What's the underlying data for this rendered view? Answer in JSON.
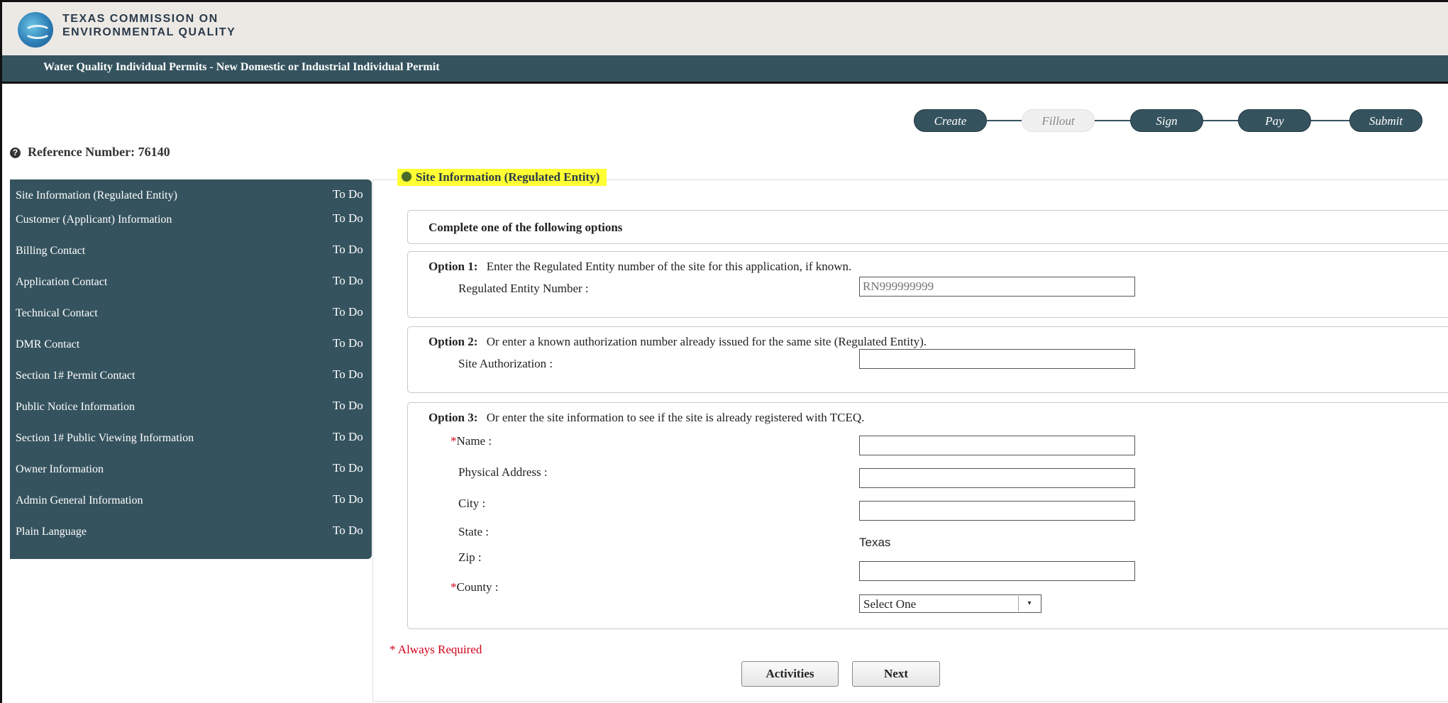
{
  "agency": {
    "line1": "TEXAS COMMISSION ON",
    "line2": "ENVIRONMENTAL QUALITY"
  },
  "title_bar": "Water Quality Individual Permits - New Domestic or Industrial Individual Permit",
  "steps": [
    {
      "label": "Create",
      "active": true
    },
    {
      "label": "Fillout",
      "active": false
    },
    {
      "label": "Sign",
      "active": true
    },
    {
      "label": "Pay",
      "active": true
    },
    {
      "label": "Submit",
      "active": true
    }
  ],
  "reference": {
    "label": "Reference Number: 76140"
  },
  "sidebar": {
    "items": [
      {
        "label": "Site Information (Regulated Entity)",
        "status": "To Do"
      },
      {
        "label": "Customer (Applicant) Information",
        "status": "To Do"
      },
      {
        "label": "Billing Contact",
        "status": "To Do"
      },
      {
        "label": "Application Contact",
        "status": "To Do"
      },
      {
        "label": "Technical Contact",
        "status": "To Do"
      },
      {
        "label": "DMR Contact",
        "status": "To Do"
      },
      {
        "label": "Section 1# Permit Contact",
        "status": "To Do"
      },
      {
        "label": "Public Notice Information",
        "status": "To Do"
      },
      {
        "label": "Section 1# Public Viewing Information",
        "status": "To Do"
      },
      {
        "label": "Owner Information",
        "status": "To Do"
      },
      {
        "label": "Admin General Information",
        "status": "To Do"
      },
      {
        "label": "Plain Language",
        "status": "To Do"
      }
    ]
  },
  "section": {
    "title": "Site Information (Regulated Entity)",
    "complete_heading": "Complete one of the following options",
    "option1": {
      "label": "Option 1:",
      "text": "Enter the Regulated Entity number of the site for this application, if known.",
      "field_label": "Regulated Entity Number :",
      "placeholder": "RN999999999"
    },
    "option2": {
      "label": "Option 2:",
      "text": "Or enter a known authorization number already issued for the same site (Regulated Entity).",
      "field_label": "Site Authorization :"
    },
    "option3": {
      "label": "Option 3:",
      "text": "Or enter the site information to see if the site is already registered with TCEQ.",
      "name_label": "Name :",
      "address_label": "Physical Address :",
      "city_label": "City :",
      "state_label": "State :",
      "state_value": "Texas",
      "zip_label": "Zip :",
      "county_label": "County :",
      "county_value": "Select One"
    }
  },
  "required_note": "* Always Required",
  "buttons": {
    "activities": "Activities",
    "next": "Next"
  },
  "colors": {
    "nav": "#35535e",
    "highlight": "#ffff33",
    "required": "#d0021b"
  },
  "icons": {
    "help": "question-circle-icon",
    "section": "leaf-icon",
    "dropdown": "caret-down-icon"
  }
}
